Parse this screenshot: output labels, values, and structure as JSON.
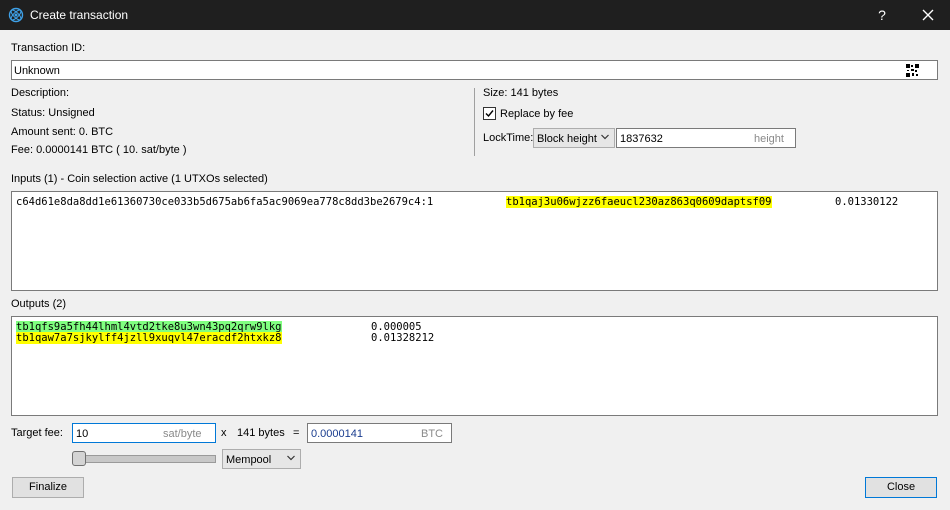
{
  "window": {
    "title": "Create transaction",
    "help_label": "?"
  },
  "txid": {
    "label": "Transaction ID:",
    "value": "Unknown"
  },
  "info": {
    "description": "Description:",
    "status": "Status: Unsigned",
    "amount_sent": "Amount sent: 0. BTC",
    "fee": "Fee: 0.0000141 BTC  ( 10. sat/byte )",
    "size": "Size: 141 bytes",
    "replace_by_fee_label": "Replace by fee",
    "replace_by_fee_checked": true,
    "locktime_label": "LockTime:",
    "locktime_type": "Block height",
    "locktime_value": "1837632",
    "locktime_unit": "height"
  },
  "inputs": {
    "header": "Inputs (1)  -  Coin selection active (1 UTXOs selected)",
    "rows": [
      {
        "prevout": "c64d61e8da8dd1e61360730ce033b5d675ab6fa5ac9069ea778c8dd3be2679c4:1",
        "address": "tb1qaj3u06wjzz6faeucl230az863q0609daptsf09",
        "amount": "0.01330122"
      }
    ]
  },
  "outputs": {
    "header": "Outputs (2)",
    "rows": [
      {
        "address": "tb1qfs9a5fh44lhml4vtd2tke8u3wn43pq2qrw9lkg",
        "amount": "0.000005"
      },
      {
        "address": "tb1qaw7a7sjkylff4jzll9xuqvl47eracdf2htxkz8",
        "amount": "0.01328212"
      }
    ]
  },
  "fee_controls": {
    "target_fee_label": "Target fee:",
    "feerate_value": "10",
    "feerate_unit": "sat/byte",
    "times": "x",
    "size": "141 bytes",
    "equals": "=",
    "fee_value": "0.0000141",
    "fee_unit": "BTC",
    "slider_level": 0.0,
    "slider_mode": "Mempool"
  },
  "buttons": {
    "finalize": "Finalize",
    "close": "Close"
  },
  "colors": {
    "titlebar_bg": "#1f1f1f",
    "change_highlight": "#ffff00",
    "recipient_highlight": "#80ff80",
    "focus_border": "#0078d7"
  },
  "icons": [
    "electrum-app-icon",
    "qr-code-icon",
    "checkmark-icon",
    "chevron-down-icon",
    "close-icon"
  ]
}
